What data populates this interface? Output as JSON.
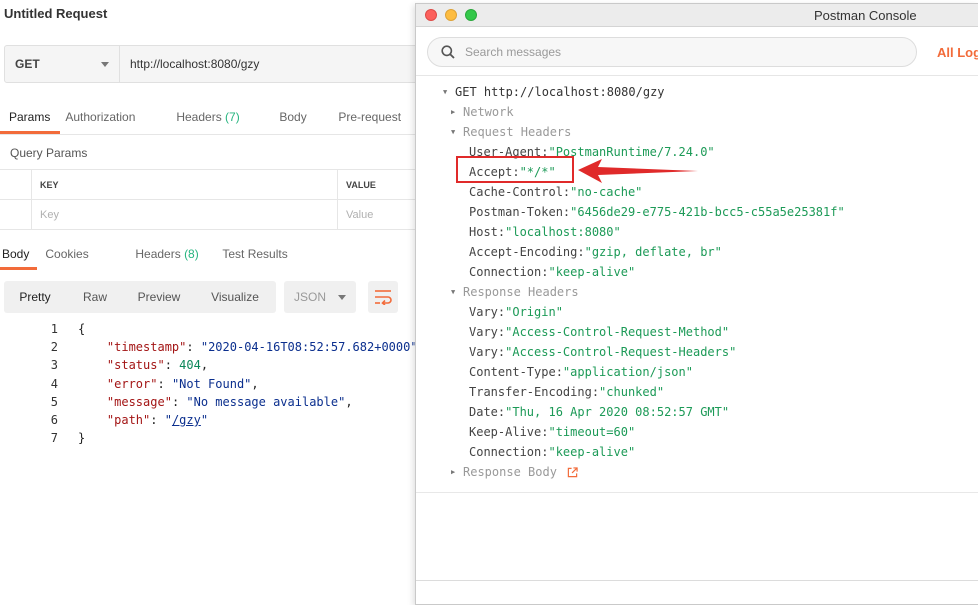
{
  "main": {
    "title": "Untitled Request",
    "method": "GET",
    "url": "http://localhost:8080/gzy",
    "tabs": [
      {
        "label": "Params"
      },
      {
        "label": "Authorization"
      },
      {
        "label": "Headers",
        "count": "(7)"
      },
      {
        "label": "Body"
      },
      {
        "label": "Pre-request"
      }
    ],
    "query_params_title": "Query Params",
    "table": {
      "key_header": "KEY",
      "value_header": "VALUE",
      "key_placeholder": "Key",
      "value_placeholder": "Value"
    },
    "response_tabs": [
      {
        "label": "Body"
      },
      {
        "label": "Cookies"
      },
      {
        "label": "Headers",
        "count": "(8)"
      },
      {
        "label": "Test Results"
      }
    ],
    "view_modes": [
      "Pretty",
      "Raw",
      "Preview",
      "Visualize"
    ],
    "format": "JSON",
    "code": {
      "line_numbers": [
        "1",
        "2",
        "3",
        "4",
        "5",
        "6",
        "7"
      ],
      "open_brace": "{",
      "close_brace": "}",
      "fields": [
        {
          "key": "\"timestamp\"",
          "value": "\"2020-04-16T08:52:57.682+0000\"",
          "suffix": ""
        },
        {
          "key": "\"status\"",
          "value": "404",
          "suffix": ","
        },
        {
          "key": "\"error\"",
          "value": "\"Not Found\"",
          "suffix": ","
        },
        {
          "key": "\"message\"",
          "value": "\"No message available\"",
          "suffix": ","
        },
        {
          "key": "\"path\"",
          "value_pre": "\"",
          "value_link": "/gzy",
          "value_post": "\"",
          "suffix": ""
        }
      ]
    }
  },
  "console": {
    "window_title": "Postman Console",
    "search_placeholder": "Search messages",
    "all_logs": "All Log",
    "request_line": "GET http://localhost:8080/gzy",
    "network_label": "Network",
    "request_headers_label": "Request Headers",
    "request_headers": [
      {
        "key": "User-Agent:",
        "value": "\"PostmanRuntime/7.24.0\""
      },
      {
        "key": "Accept:",
        "value": "\"*/*\""
      },
      {
        "key": "Cache-Control:",
        "value": "\"no-cache\""
      },
      {
        "key": "Postman-Token:",
        "value": "\"6456de29-e775-421b-bcc5-c55a5e25381f\""
      },
      {
        "key": "Host:",
        "value": "\"localhost:8080\""
      },
      {
        "key": "Accept-Encoding:",
        "value": "\"gzip, deflate, br\""
      },
      {
        "key": "Connection:",
        "value": "\"keep-alive\""
      }
    ],
    "response_headers_label": "Response Headers",
    "response_headers": [
      {
        "key": "Vary:",
        "value": "\"Origin\""
      },
      {
        "key": "Vary:",
        "value": "\"Access-Control-Request-Method\""
      },
      {
        "key": "Vary:",
        "value": "\"Access-Control-Request-Headers\""
      },
      {
        "key": "Content-Type:",
        "value": "\"application/json\""
      },
      {
        "key": "Transfer-Encoding:",
        "value": "\"chunked\""
      },
      {
        "key": "Date:",
        "value": "\"Thu, 16 Apr 2020 08:52:57 GMT\""
      },
      {
        "key": "Keep-Alive:",
        "value": "\"timeout=60\""
      },
      {
        "key": "Connection:",
        "value": "\"keep-alive\""
      }
    ],
    "response_body_label": "Response Body"
  },
  "colors": {
    "accent": "#f26b3a",
    "header_value": "#1c9a57",
    "annotation": "#e02a2a"
  },
  "icons": [
    "search-icon",
    "caret-down-icon",
    "wrap-lines-icon",
    "external-link-icon",
    "arrow-annotation-icon"
  ]
}
